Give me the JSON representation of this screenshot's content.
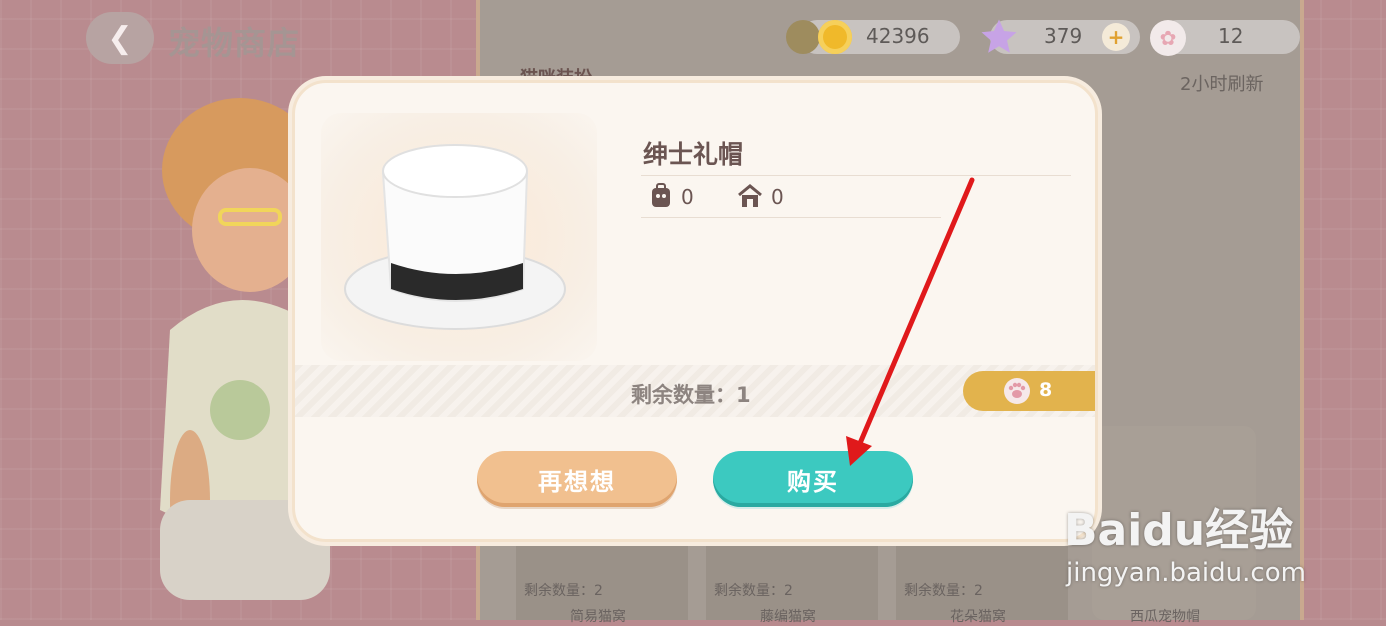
{
  "header": {
    "title": "宠物商店",
    "back_icon": "back-arrow-icon"
  },
  "currency": {
    "coins": "42396",
    "stars": "379",
    "paws": "12",
    "add_symbol": "+"
  },
  "shop": {
    "category_label": "猫咪装扮",
    "refresh_text": "2小时刷新",
    "bottom_items": [
      {
        "remaining": "剩余数量：2",
        "name": "简易猫窝"
      },
      {
        "remaining": "剩余数量：2",
        "name": "藤编猫窝"
      },
      {
        "remaining": "剩余数量：2",
        "name": "花朵猫窝"
      },
      {
        "remaining": "",
        "name": "西瓜宠物帽"
      }
    ]
  },
  "dialog": {
    "item_name": "绅士礼帽",
    "backpack_count": "0",
    "house_count": "0",
    "remaining": "剩余数量：1",
    "price": "8",
    "cancel_label": "再想想",
    "buy_label": "购买"
  },
  "watermark": {
    "brand": "Baidu经验",
    "url": "jingyan.baidu.com"
  },
  "colors": {
    "buy": "#3cc9c0",
    "cancel": "#f1c08f",
    "price_tag": "#e2b34d",
    "annotation_arrow": "#e0191b"
  }
}
